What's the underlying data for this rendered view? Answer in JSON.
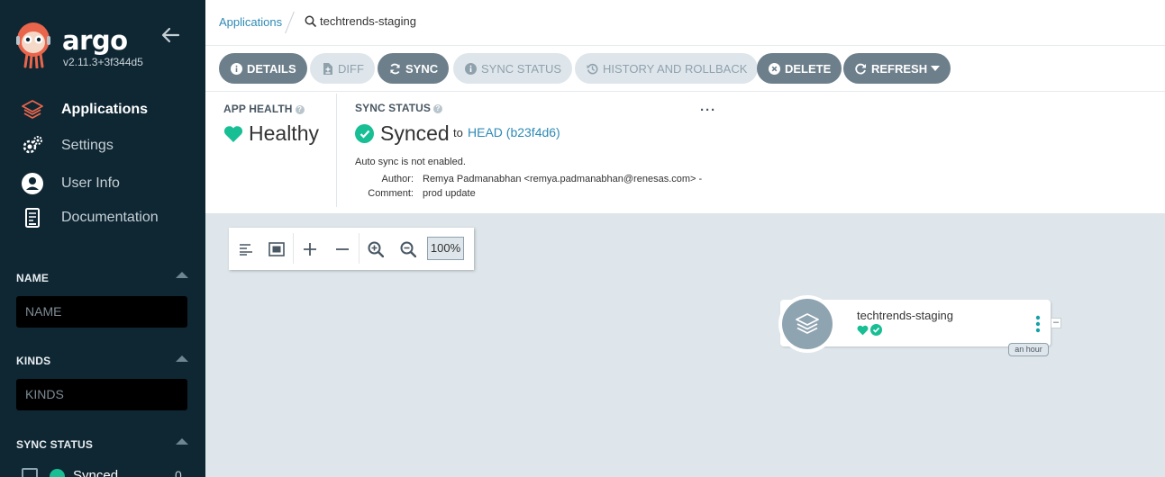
{
  "sidebar": {
    "brand": "argo",
    "version": "v2.11.3+3f344d5",
    "nav": [
      {
        "label": "Applications",
        "icon": "layers-icon",
        "active": true
      },
      {
        "label": "Settings",
        "icon": "gears-icon"
      },
      {
        "label": "User Info",
        "icon": "user-circle-icon"
      },
      {
        "label": "Documentation",
        "icon": "book-icon"
      }
    ],
    "filters": {
      "name": {
        "title": "NAME",
        "placeholder": "NAME"
      },
      "kinds": {
        "title": "KINDS",
        "placeholder": "KINDS"
      },
      "sync_status": {
        "title": "SYNC STATUS",
        "items": [
          {
            "label": "Synced",
            "count": "0"
          }
        ]
      }
    }
  },
  "breadcrumb": {
    "root": "Applications",
    "current": "techtrends-staging"
  },
  "toolbar": {
    "details": "DETAILS",
    "diff": "DIFF",
    "sync": "SYNC",
    "sync_status": "SYNC STATUS",
    "history": "HISTORY AND ROLLBACK",
    "delete": "DELETE",
    "refresh": "REFRESH"
  },
  "status": {
    "health_label": "APP HEALTH",
    "health_value": "Healthy",
    "sync_label": "SYNC STATUS",
    "sync_value": "Synced",
    "to": "to",
    "revision": "HEAD (b23f4d6)",
    "auto_sync": "Auto sync is not enabled.",
    "author_label": "Author:",
    "author_value": "Remya Padmanabhan <remya.padmanabhan@renesas.com> -",
    "comment_label": "Comment:",
    "comment_value": "prod update",
    "more": "···"
  },
  "graph": {
    "zoom": "100%",
    "node": {
      "name": "techtrends-staging",
      "age": "an hour"
    }
  },
  "colors": {
    "sidebar_bg": "#0f2733",
    "accent_teal": "#18be94",
    "link_blue": "#2e8ab5",
    "button_dark": "#6d7f8b",
    "button_light": "#dee6eb",
    "canvas_bg": "#dee6eb"
  }
}
